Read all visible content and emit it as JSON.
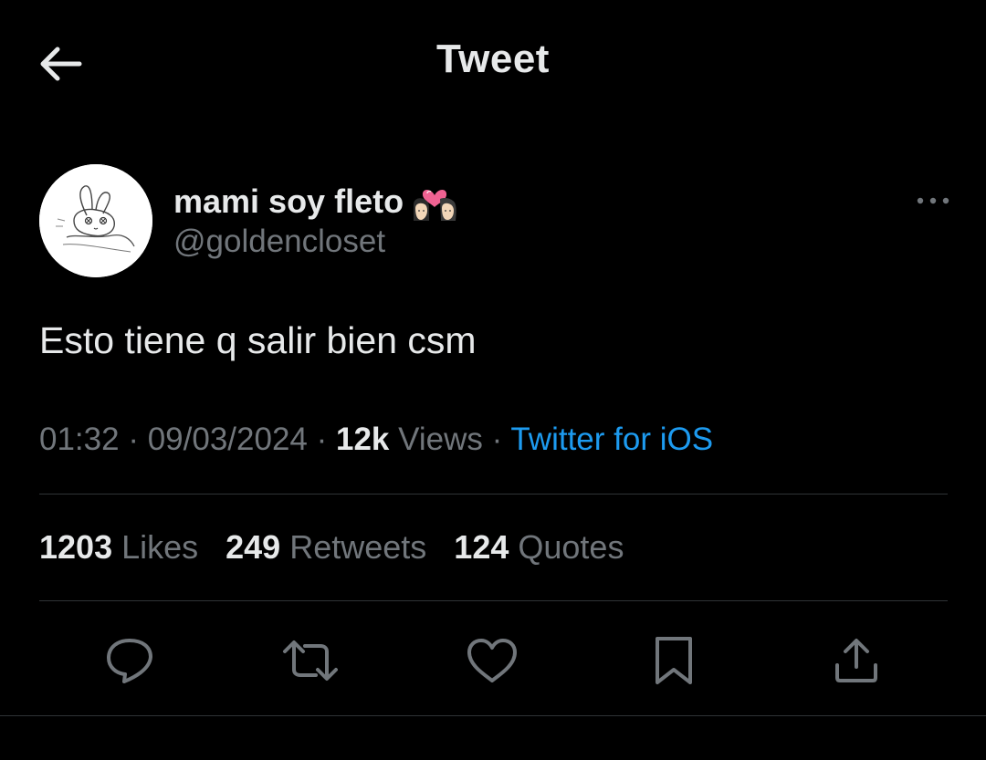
{
  "header": {
    "title": "Tweet",
    "back_icon": "arrow-left-icon"
  },
  "author": {
    "display_name": "mami soy fleto",
    "name_emoji": "couple-with-heart-emoji",
    "handle": "@goldencloset",
    "avatar": "bunny-sketch-avatar"
  },
  "tweet": {
    "text": "Esto tiene q salir bien csm"
  },
  "meta": {
    "time": "01:32",
    "sep1": " · ",
    "date": "09/03/2024",
    "sep2": " · ",
    "views_count": "12k",
    "views_label": " Views",
    "sep3": " · ",
    "source": "Twitter for iOS"
  },
  "stats": {
    "likes_count": "1203",
    "likes_label": " Likes",
    "retweets_count": "249",
    "retweets_label": " Retweets",
    "quotes_count": "124",
    "quotes_label": " Quotes"
  },
  "actions": [
    "reply-icon",
    "retweet-icon",
    "like-icon",
    "bookmark-icon",
    "share-icon"
  ],
  "colors": {
    "background": "#000000",
    "text": "#e7e9ea",
    "secondary": "#71767b",
    "link": "#1d9bf0",
    "divider": "#2f3336"
  }
}
